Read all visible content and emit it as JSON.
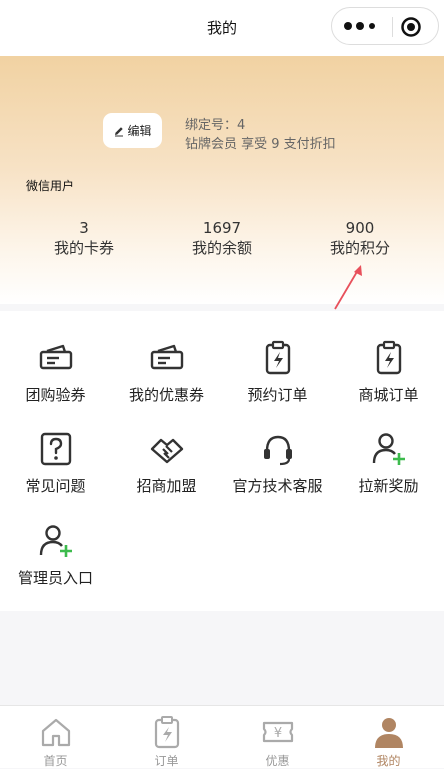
{
  "navbar": {
    "title": "我的"
  },
  "profile": {
    "edit_label": "编辑",
    "bind_number": "绑定号：4",
    "member_info": "钻牌会员 享受 9 支付折扣",
    "nickname": "微信用户"
  },
  "stats": [
    {
      "value": "3",
      "label": "我的卡券"
    },
    {
      "value": "1697",
      "label": "我的余额"
    },
    {
      "value": "900",
      "label": "我的积分"
    }
  ],
  "menu": [
    {
      "label": "团购验券",
      "icon": "ticket-icon"
    },
    {
      "label": "我的优惠券",
      "icon": "ticket-icon"
    },
    {
      "label": "预约订单",
      "icon": "clipboard-bolt-icon"
    },
    {
      "label": "商城订单",
      "icon": "clipboard-bolt-icon"
    },
    {
      "label": "常见问题",
      "icon": "question-icon"
    },
    {
      "label": "招商加盟",
      "icon": "handshake-icon"
    },
    {
      "label": "官方技术客服",
      "icon": "headset-icon"
    },
    {
      "label": "拉新奖励",
      "icon": "add-user-icon"
    },
    {
      "label": "管理员入口",
      "icon": "add-user-icon"
    }
  ],
  "tabbar": [
    {
      "label": "首页",
      "icon": "home-icon",
      "active": false
    },
    {
      "label": "订单",
      "icon": "order-icon",
      "active": false
    },
    {
      "label": "优惠",
      "icon": "coupon-icon",
      "active": false
    },
    {
      "label": "我的",
      "icon": "user-icon",
      "active": true
    }
  ],
  "colors": {
    "accent": "#b08562",
    "header_top": "#f1d2a2",
    "plus_green": "#3dbb4d",
    "arrow_red": "#e8505b"
  }
}
